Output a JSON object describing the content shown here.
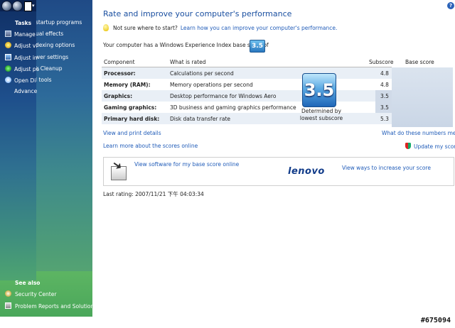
{
  "back_pane": {
    "items": [
      "startup programs",
      "ual effects",
      "dexing options",
      "wer settings",
      "k Cleanup",
      "l tools"
    ]
  },
  "front_pane": {
    "tasks_title": "Tasks",
    "items": [
      {
        "label": "Manage",
        "icon": "manage-icon"
      },
      {
        "label": "Adjust vi",
        "icon": "adjust-visual-icon"
      },
      {
        "label": "Adjust in",
        "icon": "adjust-indexing-icon"
      },
      {
        "label": "Adjust po",
        "icon": "adjust-power-icon"
      },
      {
        "label": "Open Di",
        "icon": "open-disk-icon"
      },
      {
        "label": "Advance",
        "icon": ""
      }
    ]
  },
  "see_also": {
    "title": "See also",
    "items": [
      {
        "label": "Security Center",
        "icon": "security-center-icon"
      },
      {
        "label": "Problem Reports and Solutions",
        "icon": "problem-reports-icon"
      }
    ]
  },
  "main": {
    "title": "Rate and improve your computer's performance",
    "tip_text": "Not sure where to start?",
    "tip_link": "Learn how you can improve your computer's performance.",
    "base_line": "Your computer has a Windows Experience Index base score of",
    "base_score": "3.5",
    "table": {
      "headers": {
        "component": "Component",
        "rated": "What is rated",
        "subscore": "Subscore",
        "base": "Base score"
      },
      "rows": [
        {
          "component": "Processor:",
          "rated": "Calculations per second",
          "subscore": "4.8"
        },
        {
          "component": "Memory (RAM):",
          "rated": "Memory operations per second",
          "subscore": "4.8"
        },
        {
          "component": "Graphics:",
          "rated": "Desktop performance for Windows Aero",
          "subscore": "3.5"
        },
        {
          "component": "Gaming graphics:",
          "rated": "3D business and gaming graphics performance",
          "subscore": "3.5"
        },
        {
          "component": "Primary hard disk:",
          "rated": "Disk data transfer rate",
          "subscore": "5.3"
        }
      ],
      "base_caption": "Determined by lowest subscore"
    },
    "links": {
      "view_print": "View and print details",
      "what_numbers": "What do these numbers mean?",
      "learn_more": "Learn more about the scores online",
      "update": "Update my score"
    },
    "banner": {
      "software_link": "View software for my base score online",
      "brand": "lenovo",
      "ways_link": "View ways to increase your score"
    },
    "last_rating": "Last rating: 2007/11/21 下午 04:03:34"
  },
  "watermark": "#675094",
  "colors": {
    "title": "#1a4fa0",
    "link": "#1f5bb8",
    "brand": "#123c8a"
  }
}
